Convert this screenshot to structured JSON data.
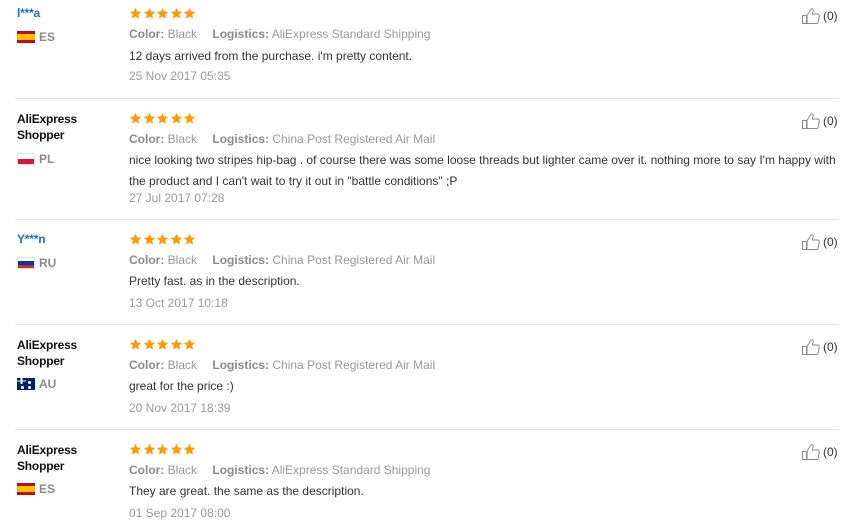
{
  "reviews": [
    {
      "user": "l***a",
      "user_style": "masked",
      "country_code": "ES",
      "flag": "flag-es",
      "rating_stars": 5,
      "color_label": "Color:",
      "color_value": "Black",
      "logistics_label": "Logistics:",
      "logistics_value": "AliExpress Standard Shipping",
      "text": "12 days arrived from the purchase. i'm pretty content.",
      "date": "25 Nov 2017 05:35",
      "helpful_count": "(0)"
    },
    {
      "user": "AliExpress Shopper",
      "user_style": "plain",
      "country_code": "PL",
      "flag": "flag-pl",
      "rating_stars": 5,
      "color_label": "Color:",
      "color_value": "Black",
      "logistics_label": "Logistics:",
      "logistics_value": "China Post Registered Air Mail",
      "text": "nice looking two stripes hip-bag . of course there was some loose threads but lighter came over it. nothing more to say I'm happy with the product and I can't wait to try it out in \"battle conditions\" ;P",
      "date": "27 Jul 2017 07:28",
      "helpful_count": "(0)"
    },
    {
      "user": "Y***n",
      "user_style": "masked",
      "country_code": "RU",
      "flag": "flag-ru",
      "rating_stars": 5,
      "color_label": "Color:",
      "color_value": "Black",
      "logistics_label": "Logistics:",
      "logistics_value": "China Post Registered Air Mail",
      "text": "Pretty fast. as in the description.",
      "date": "13 Oct 2017 10:18",
      "helpful_count": "(0)"
    },
    {
      "user": "AliExpress Shopper",
      "user_style": "plain",
      "country_code": "AU",
      "flag": "flag-au",
      "rating_stars": 5,
      "color_label": "Color:",
      "color_value": "Black",
      "logistics_label": "Logistics:",
      "logistics_value": "China Post Registered Air Mail",
      "text": "great for the price :)",
      "date": "20 Nov 2017 18:39",
      "helpful_count": "(0)"
    },
    {
      "user": "AliExpress Shopper",
      "user_style": "plain",
      "country_code": "ES",
      "flag": "flag-es",
      "rating_stars": 5,
      "color_label": "Color:",
      "color_value": "Black",
      "logistics_label": "Logistics:",
      "logistics_value": "AliExpress Standard Shipping",
      "text": "They are great. the same as the description.",
      "date": "01 Sep 2017 08:00",
      "helpful_count": "(0)"
    }
  ],
  "colors": {
    "star": "#ff9a00",
    "link_user": "#1c6fb8",
    "meta": "#999999",
    "text": "#333333",
    "divider": "#e6e6e6"
  },
  "icons": {
    "star": "star-icon",
    "thumb": "thumbs-up-icon"
  }
}
